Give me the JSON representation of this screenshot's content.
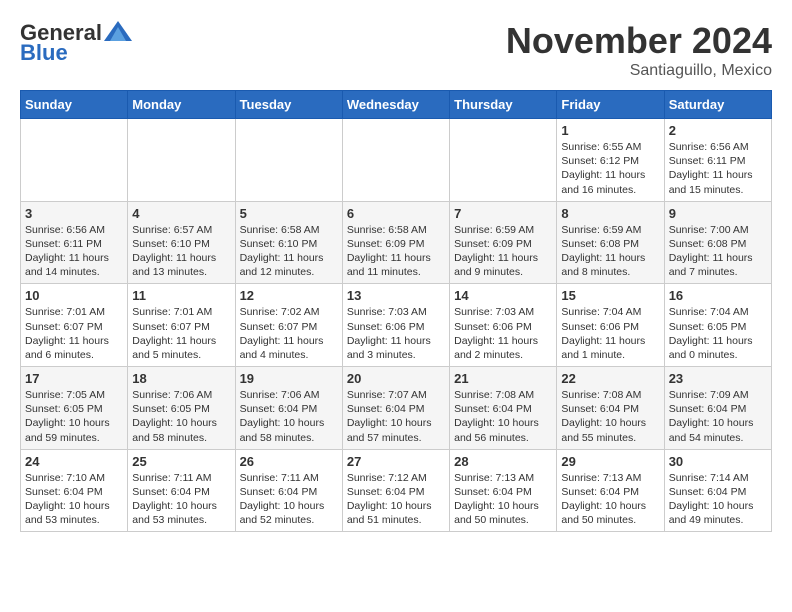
{
  "header": {
    "logo_general": "General",
    "logo_blue": "Blue",
    "month_title": "November 2024",
    "subtitle": "Santiaguillo, Mexico"
  },
  "days_of_week": [
    "Sunday",
    "Monday",
    "Tuesday",
    "Wednesday",
    "Thursday",
    "Friday",
    "Saturday"
  ],
  "weeks": [
    [
      {
        "day": "",
        "info": ""
      },
      {
        "day": "",
        "info": ""
      },
      {
        "day": "",
        "info": ""
      },
      {
        "day": "",
        "info": ""
      },
      {
        "day": "",
        "info": ""
      },
      {
        "day": "1",
        "info": "Sunrise: 6:55 AM\nSunset: 6:12 PM\nDaylight: 11 hours and 16 minutes."
      },
      {
        "day": "2",
        "info": "Sunrise: 6:56 AM\nSunset: 6:11 PM\nDaylight: 11 hours and 15 minutes."
      }
    ],
    [
      {
        "day": "3",
        "info": "Sunrise: 6:56 AM\nSunset: 6:11 PM\nDaylight: 11 hours and 14 minutes."
      },
      {
        "day": "4",
        "info": "Sunrise: 6:57 AM\nSunset: 6:10 PM\nDaylight: 11 hours and 13 minutes."
      },
      {
        "day": "5",
        "info": "Sunrise: 6:58 AM\nSunset: 6:10 PM\nDaylight: 11 hours and 12 minutes."
      },
      {
        "day": "6",
        "info": "Sunrise: 6:58 AM\nSunset: 6:09 PM\nDaylight: 11 hours and 11 minutes."
      },
      {
        "day": "7",
        "info": "Sunrise: 6:59 AM\nSunset: 6:09 PM\nDaylight: 11 hours and 9 minutes."
      },
      {
        "day": "8",
        "info": "Sunrise: 6:59 AM\nSunset: 6:08 PM\nDaylight: 11 hours and 8 minutes."
      },
      {
        "day": "9",
        "info": "Sunrise: 7:00 AM\nSunset: 6:08 PM\nDaylight: 11 hours and 7 minutes."
      }
    ],
    [
      {
        "day": "10",
        "info": "Sunrise: 7:01 AM\nSunset: 6:07 PM\nDaylight: 11 hours and 6 minutes."
      },
      {
        "day": "11",
        "info": "Sunrise: 7:01 AM\nSunset: 6:07 PM\nDaylight: 11 hours and 5 minutes."
      },
      {
        "day": "12",
        "info": "Sunrise: 7:02 AM\nSunset: 6:07 PM\nDaylight: 11 hours and 4 minutes."
      },
      {
        "day": "13",
        "info": "Sunrise: 7:03 AM\nSunset: 6:06 PM\nDaylight: 11 hours and 3 minutes."
      },
      {
        "day": "14",
        "info": "Sunrise: 7:03 AM\nSunset: 6:06 PM\nDaylight: 11 hours and 2 minutes."
      },
      {
        "day": "15",
        "info": "Sunrise: 7:04 AM\nSunset: 6:06 PM\nDaylight: 11 hours and 1 minute."
      },
      {
        "day": "16",
        "info": "Sunrise: 7:04 AM\nSunset: 6:05 PM\nDaylight: 11 hours and 0 minutes."
      }
    ],
    [
      {
        "day": "17",
        "info": "Sunrise: 7:05 AM\nSunset: 6:05 PM\nDaylight: 10 hours and 59 minutes."
      },
      {
        "day": "18",
        "info": "Sunrise: 7:06 AM\nSunset: 6:05 PM\nDaylight: 10 hours and 58 minutes."
      },
      {
        "day": "19",
        "info": "Sunrise: 7:06 AM\nSunset: 6:04 PM\nDaylight: 10 hours and 58 minutes."
      },
      {
        "day": "20",
        "info": "Sunrise: 7:07 AM\nSunset: 6:04 PM\nDaylight: 10 hours and 57 minutes."
      },
      {
        "day": "21",
        "info": "Sunrise: 7:08 AM\nSunset: 6:04 PM\nDaylight: 10 hours and 56 minutes."
      },
      {
        "day": "22",
        "info": "Sunrise: 7:08 AM\nSunset: 6:04 PM\nDaylight: 10 hours and 55 minutes."
      },
      {
        "day": "23",
        "info": "Sunrise: 7:09 AM\nSunset: 6:04 PM\nDaylight: 10 hours and 54 minutes."
      }
    ],
    [
      {
        "day": "24",
        "info": "Sunrise: 7:10 AM\nSunset: 6:04 PM\nDaylight: 10 hours and 53 minutes."
      },
      {
        "day": "25",
        "info": "Sunrise: 7:11 AM\nSunset: 6:04 PM\nDaylight: 10 hours and 53 minutes."
      },
      {
        "day": "26",
        "info": "Sunrise: 7:11 AM\nSunset: 6:04 PM\nDaylight: 10 hours and 52 minutes."
      },
      {
        "day": "27",
        "info": "Sunrise: 7:12 AM\nSunset: 6:04 PM\nDaylight: 10 hours and 51 minutes."
      },
      {
        "day": "28",
        "info": "Sunrise: 7:13 AM\nSunset: 6:04 PM\nDaylight: 10 hours and 50 minutes."
      },
      {
        "day": "29",
        "info": "Sunrise: 7:13 AM\nSunset: 6:04 PM\nDaylight: 10 hours and 50 minutes."
      },
      {
        "day": "30",
        "info": "Sunrise: 7:14 AM\nSunset: 6:04 PM\nDaylight: 10 hours and 49 minutes."
      }
    ]
  ]
}
